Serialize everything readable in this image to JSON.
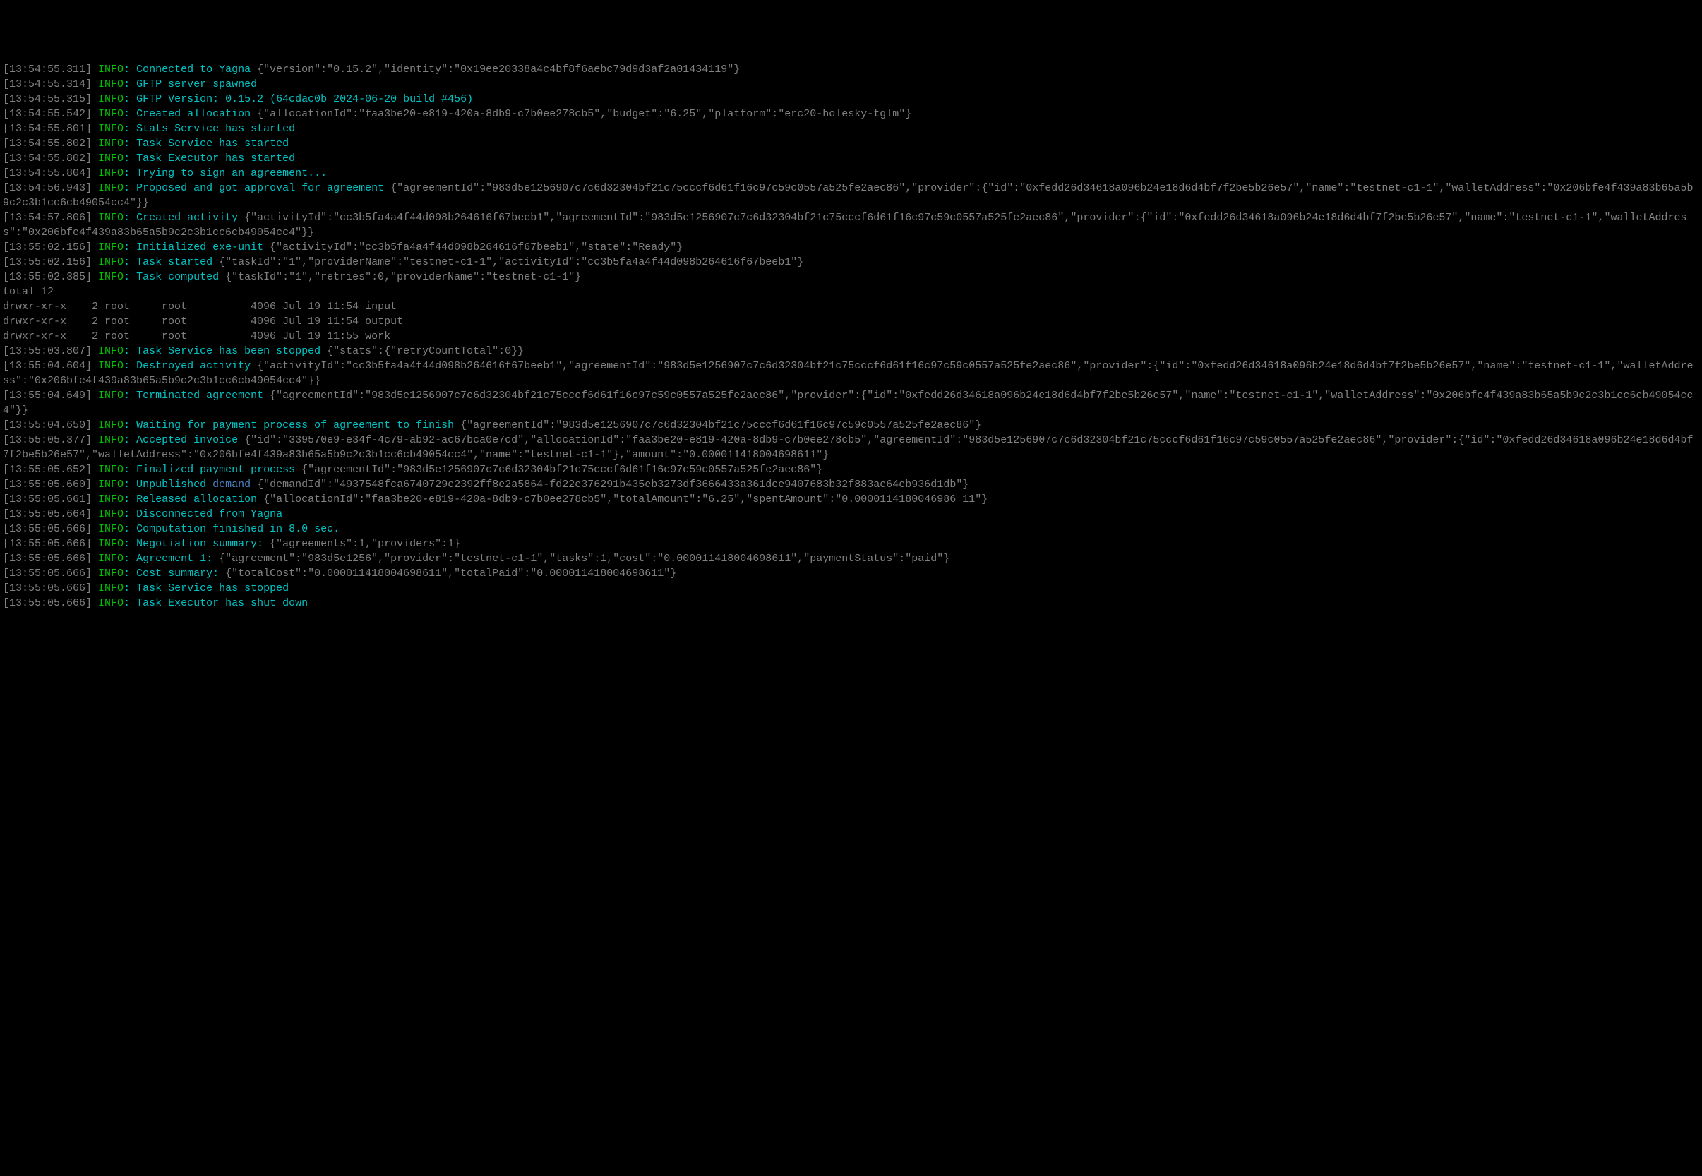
{
  "colors": {
    "timestamp": "#808080",
    "level_info": "#00c200",
    "message": "#00c2c2",
    "json": "#808080",
    "link": "#4a7fbf",
    "background": "#000000"
  },
  "lines": [
    {
      "ts": "[13:54:55.311]",
      "level": "INFO",
      "msg": "Connected to Yagna",
      "json": "{\"version\":\"0.15.2\",\"identity\":\"0x19ee20338a4c4bf8f6aebc79d9d3af2a01434119\"}"
    },
    {
      "ts": "[13:54:55.314]",
      "level": "INFO",
      "msg": "GFTP server spawned",
      "json": ""
    },
    {
      "ts": "[13:54:55.315]",
      "level": "INFO",
      "msg": "GFTP Version: 0.15.2 (64cdac0b 2024-06-20 build #456)",
      "json": ""
    },
    {
      "ts": "[13:54:55.542]",
      "level": "INFO",
      "msg": "Created allocation",
      "json": "{\"allocationId\":\"faa3be20-e819-420a-8db9-c7b0ee278cb5\",\"budget\":\"6.25\",\"platform\":\"erc20-holesky-tglm\"}"
    },
    {
      "ts": "[13:54:55.801]",
      "level": "INFO",
      "msg": "Stats Service has started",
      "json": ""
    },
    {
      "ts": "[13:54:55.802]",
      "level": "INFO",
      "msg": "Task Service has started",
      "json": ""
    },
    {
      "ts": "[13:54:55.802]",
      "level": "INFO",
      "msg": "Task Executor has started",
      "json": ""
    },
    {
      "ts": "[13:54:55.804]",
      "level": "INFO",
      "msg": "Trying to sign an agreement...",
      "json": ""
    },
    {
      "ts": "[13:54:56.943]",
      "level": "INFO",
      "msg": "Proposed and got approval for agreement",
      "json": "{\"agreementId\":\"983d5e1256907c7c6d32304bf21c75cccf6d61f16c97c59c0557a525fe2aec86\",\"provider\":{\"id\":\"0xfedd26d34618a096b24e18d6d4bf7f2be5b26e57\",\"name\":\"testnet-c1-1\",\"walletAddress\":\"0x206bfe4f439a83b65a5b9c2c3b1cc6cb49054cc4\"}}"
    },
    {
      "ts": "[13:54:57.806]",
      "level": "INFO",
      "msg": "Created activity",
      "json": "{\"activityId\":\"cc3b5fa4a4f44d098b264616f67beeb1\",\"agreementId\":\"983d5e1256907c7c6d32304bf21c75cccf6d61f16c97c59c0557a525fe2aec86\",\"provider\":{\"id\":\"0xfedd26d34618a096b24e18d6d4bf7f2be5b26e57\",\"name\":\"testnet-c1-1\",\"walletAddress\":\"0x206bfe4f439a83b65a5b9c2c3b1cc6cb49054cc4\"}}"
    },
    {
      "ts": "[13:55:02.156]",
      "level": "INFO",
      "msg": "Initialized exe-unit",
      "json": "{\"activityId\":\"cc3b5fa4a4f44d098b264616f67beeb1\",\"state\":\"Ready\"}"
    },
    {
      "ts": "[13:55:02.156]",
      "level": "INFO",
      "msg": "Task started",
      "json": "{\"taskId\":\"1\",\"providerName\":\"testnet-c1-1\",\"activityId\":\"cc3b5fa4a4f44d098b264616f67beeb1\"}"
    },
    {
      "ts": "[13:55:02.385]",
      "level": "INFO",
      "msg": "Task computed",
      "json": "{\"taskId\":\"1\",\"retries\":0,\"providerName\":\"testnet-c1-1\"}"
    },
    {
      "raw": "total 12"
    },
    {
      "raw": "drwxr-xr-x    2 root     root          4096 Jul 19 11:54 input"
    },
    {
      "raw": "drwxr-xr-x    2 root     root          4096 Jul 19 11:54 output"
    },
    {
      "raw": "drwxr-xr-x    2 root     root          4096 Jul 19 11:55 work"
    },
    {
      "raw": ""
    },
    {
      "ts": "[13:55:03.807]",
      "level": "INFO",
      "msg": "Task Service has been stopped",
      "json": "{\"stats\":{\"retryCountTotal\":0}}"
    },
    {
      "ts": "[13:55:04.604]",
      "level": "INFO",
      "msg": "Destroyed activity",
      "json": "{\"activityId\":\"cc3b5fa4a4f44d098b264616f67beeb1\",\"agreementId\":\"983d5e1256907c7c6d32304bf21c75cccf6d61f16c97c59c0557a525fe2aec86\",\"provider\":{\"id\":\"0xfedd26d34618a096b24e18d6d4bf7f2be5b26e57\",\"name\":\"testnet-c1-1\",\"walletAddress\":\"0x206bfe4f439a83b65a5b9c2c3b1cc6cb49054cc4\"}}"
    },
    {
      "ts": "[13:55:04.649]",
      "level": "INFO",
      "msg": "Terminated agreement",
      "json": "{\"agreementId\":\"983d5e1256907c7c6d32304bf21c75cccf6d61f16c97c59c0557a525fe2aec86\",\"provider\":{\"id\":\"0xfedd26d34618a096b24e18d6d4bf7f2be5b26e57\",\"name\":\"testnet-c1-1\",\"walletAddress\":\"0x206bfe4f439a83b65a5b9c2c3b1cc6cb49054cc4\"}}"
    },
    {
      "ts": "[13:55:04.650]",
      "level": "INFO",
      "msg": "Waiting for payment process of agreement to finish",
      "json": "{\"agreementId\":\"983d5e1256907c7c6d32304bf21c75cccf6d61f16c97c59c0557a525fe2aec86\"}"
    },
    {
      "ts": "[13:55:05.377]",
      "level": "INFO",
      "msg": "Accepted invoice",
      "json": "{\"id\":\"339570e9-e34f-4c79-ab92-ac67bca0e7cd\",\"allocationId\":\"faa3be20-e819-420a-8db9-c7b0ee278cb5\",\"agreementId\":\"983d5e1256907c7c6d32304bf21c75cccf6d61f16c97c59c0557a525fe2aec86\",\"provider\":{\"id\":\"0xfedd26d34618a096b24e18d6d4bf7f2be5b26e57\",\"walletAddress\":\"0x206bfe4f439a83b65a5b9c2c3b1cc6cb49054cc4\",\"name\":\"testnet-c1-1\"},\"amount\":\"0.000011418004698611\"}"
    },
    {
      "ts": "[13:55:05.652]",
      "level": "INFO",
      "msg": "Finalized payment process",
      "json": "{\"agreementId\":\"983d5e1256907c7c6d32304bf21c75cccf6d61f16c97c59c0557a525fe2aec86\"}"
    },
    {
      "ts": "[13:55:05.660]",
      "level": "INFO",
      "msg": "Unpublished",
      "link": "demand",
      "json": "{\"demandId\":\"4937548fca6740729e2392ff8e2a5864-fd22e376291b435eb3273df3666433a361dce9407683b32f883ae64eb936d1db\"}"
    },
    {
      "ts": "[13:55:05.661]",
      "level": "INFO",
      "msg": "Released allocation",
      "json": "{\"allocationId\":\"faa3be20-e819-420a-8db9-c7b0ee278cb5\",\"totalAmount\":\"6.25\",\"spentAmount\":\"0.0000114180046986 11\"}"
    },
    {
      "ts": "[13:55:05.664]",
      "level": "INFO",
      "msg": "Disconnected from Yagna",
      "json": ""
    },
    {
      "ts": "[13:55:05.666]",
      "level": "INFO",
      "msg": "Computation finished in 8.0 sec.",
      "json": ""
    },
    {
      "ts": "[13:55:05.666]",
      "level": "INFO",
      "msg": "Negotiation summary:",
      "json": "{\"agreements\":1,\"providers\":1}"
    },
    {
      "ts": "[13:55:05.666]",
      "level": "INFO",
      "msg": "Agreement 1:",
      "json": "{\"agreement\":\"983d5e1256\",\"provider\":\"testnet-c1-1\",\"tasks\":1,\"cost\":\"0.000011418004698611\",\"paymentStatus\":\"paid\"}"
    },
    {
      "ts": "[13:55:05.666]",
      "level": "INFO",
      "msg": "Cost summary:",
      "json": "{\"totalCost\":\"0.000011418004698611\",\"totalPaid\":\"0.000011418004698611\"}"
    },
    {
      "ts": "[13:55:05.666]",
      "level": "INFO",
      "msg": "Task Service has stopped",
      "json": ""
    },
    {
      "ts": "[13:55:05.666]",
      "level": "INFO",
      "msg": "Task Executor has shut down",
      "json": ""
    }
  ]
}
